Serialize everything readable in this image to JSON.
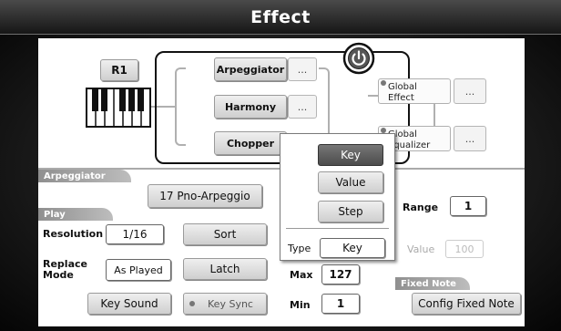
{
  "title": "Effect",
  "part": "R1",
  "chain": {
    "arpeggiator": "Arpeggiator",
    "harmony": "Harmony",
    "chopper": "Chopper",
    "more": "..."
  },
  "global": {
    "effect": "Global\nEffect",
    "equalizer": "Global\nEqualizer",
    "more": "..."
  },
  "arp_section": {
    "header": "Arpeggiator",
    "preset": "17 Pno-Arpeggio",
    "play_header": "Play",
    "resolution_label": "Resolution",
    "resolution_value": "1/16",
    "sort_label": "Sort",
    "replace_mode_label": "Replace\nMode",
    "replace_mode_value": "As Played",
    "latch_label": "Latch",
    "key_sound_label": "Key Sound",
    "key_sync_label": "Key Sync"
  },
  "popup": {
    "options": [
      "Key",
      "Value",
      "Step"
    ],
    "selected": "Key",
    "type_label": "Type",
    "type_value": "Key"
  },
  "range": {
    "label": "Range",
    "value": "1"
  },
  "value_field": {
    "label": "Value",
    "value": "100"
  },
  "max": {
    "label": "Max",
    "value": "127"
  },
  "min": {
    "label": "Min",
    "value": "1"
  },
  "fixed_note": {
    "header": "Fixed Note",
    "button": "Config Fixed Note"
  },
  "colors": {
    "selected_option": "#5e5e5e",
    "title_bar": "#2a2a2a"
  }
}
